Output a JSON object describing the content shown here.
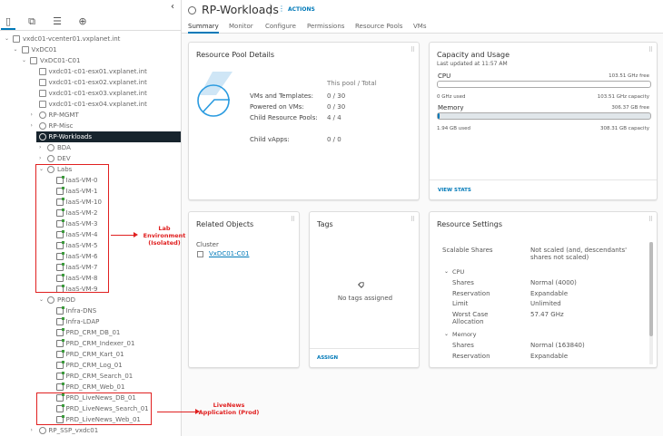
{
  "sidebar": {
    "tabs": [
      {
        "icon": "hosts-clusters-icon"
      },
      {
        "icon": "vms-templates-icon"
      },
      {
        "icon": "storage-icon"
      },
      {
        "icon": "networking-icon"
      }
    ],
    "tree": [
      {
        "label": "vxdc01-vcenter01.vxplanet.int",
        "depth": 0,
        "type": "vcenter",
        "expanded": true
      },
      {
        "label": "VxDC01",
        "depth": 1,
        "type": "datacenter",
        "expanded": true
      },
      {
        "label": "VxDC01-C01",
        "depth": 2,
        "type": "cluster",
        "expanded": true
      },
      {
        "label": "vxdc01-c01-esx01.vxplanet.int",
        "depth": 3,
        "type": "host"
      },
      {
        "label": "vxdc01-c01-esx02.vxplanet.int",
        "depth": 3,
        "type": "host"
      },
      {
        "label": "vxdc01-c01-esx03.vxplanet.int",
        "depth": 3,
        "type": "host"
      },
      {
        "label": "vxdc01-c01-esx04.vxplanet.int",
        "depth": 3,
        "type": "host"
      },
      {
        "label": "RP-MGMT",
        "depth": 3,
        "type": "rp",
        "expanded": false
      },
      {
        "label": "RP-Misc",
        "depth": 3,
        "type": "rp",
        "expanded": false
      },
      {
        "label": "RP-Workloads",
        "depth": 3,
        "type": "rp",
        "expanded": true,
        "selected": true
      },
      {
        "label": "BDA",
        "depth": 4,
        "type": "rp",
        "expanded": false
      },
      {
        "label": "DEV",
        "depth": 4,
        "type": "rp",
        "expanded": false
      },
      {
        "label": "Labs",
        "depth": 4,
        "type": "rp",
        "expanded": true
      },
      {
        "label": "IaaS-VM-0",
        "depth": 5,
        "type": "vm"
      },
      {
        "label": "IaaS-VM-1",
        "depth": 5,
        "type": "vm"
      },
      {
        "label": "IaaS-VM-10",
        "depth": 5,
        "type": "vm"
      },
      {
        "label": "IaaS-VM-2",
        "depth": 5,
        "type": "vm"
      },
      {
        "label": "IaaS-VM-3",
        "depth": 5,
        "type": "vm"
      },
      {
        "label": "IaaS-VM-4",
        "depth": 5,
        "type": "vm"
      },
      {
        "label": "IaaS-VM-5",
        "depth": 5,
        "type": "vm"
      },
      {
        "label": "IaaS-VM-6",
        "depth": 5,
        "type": "vm"
      },
      {
        "label": "IaaS-VM-7",
        "depth": 5,
        "type": "vm"
      },
      {
        "label": "IaaS-VM-8",
        "depth": 5,
        "type": "vm"
      },
      {
        "label": "IaaS-VM-9",
        "depth": 5,
        "type": "vm"
      },
      {
        "label": "PROD",
        "depth": 4,
        "type": "rp",
        "expanded": true
      },
      {
        "label": "Infra-DNS",
        "depth": 5,
        "type": "vm"
      },
      {
        "label": "Infra-LDAP",
        "depth": 5,
        "type": "vm"
      },
      {
        "label": "PRD_CRM_DB_01",
        "depth": 5,
        "type": "vm"
      },
      {
        "label": "PRD_CRM_Indexer_01",
        "depth": 5,
        "type": "vm"
      },
      {
        "label": "PRD_CRM_Kart_01",
        "depth": 5,
        "type": "vm"
      },
      {
        "label": "PRD_CRM_Log_01",
        "depth": 5,
        "type": "vm"
      },
      {
        "label": "PRD_CRM_Search_01",
        "depth": 5,
        "type": "vm"
      },
      {
        "label": "PRD_CRM_Web_01",
        "depth": 5,
        "type": "vm"
      },
      {
        "label": "PRD_LiveNews_DB_01",
        "depth": 5,
        "type": "vm"
      },
      {
        "label": "PRD_LiveNews_Search_01",
        "depth": 5,
        "type": "vm"
      },
      {
        "label": "PRD_LiveNews_Web_01",
        "depth": 5,
        "type": "vm"
      },
      {
        "label": "RP_SSP_vxdc01",
        "depth": 3,
        "type": "rp",
        "expanded": false
      }
    ]
  },
  "annotations": {
    "labs": "Lab Environment (Isolated)",
    "livenews": "LiveNews Application (Prod)",
    "color": "#e02020"
  },
  "header": {
    "title": "RP-Workloads",
    "actions": "ACTIONS"
  },
  "tabs": [
    "Summary",
    "Monitor",
    "Configure",
    "Permissions",
    "Resource Pools",
    "VMs"
  ],
  "details": {
    "title": "Resource Pool Details",
    "col_header": "This pool / Total",
    "rows": [
      {
        "k": "VMs and Templates:",
        "v": "0 / 30"
      },
      {
        "k": "Powered on VMs:",
        "v": "0 / 30"
      },
      {
        "k": "Child Resource Pools:",
        "v": "4 / 4"
      },
      {
        "k": "Child vApps:",
        "v": "0 / 0"
      }
    ]
  },
  "capacity": {
    "title": "Capacity and Usage",
    "updated": "Last updated at 11:57 AM",
    "cpu": {
      "label": "CPU",
      "free": "103.51 GHz free",
      "used": "0 GHz used",
      "capacity": "103.51 GHz capacity",
      "fraction": 0
    },
    "memory": {
      "label": "Memory",
      "free": "306.37 GB free",
      "used": "1.94 GB used",
      "capacity": "308.31 GB capacity",
      "fraction": 0.0063
    },
    "view_stats": "VIEW STATS"
  },
  "related": {
    "title": "Related Objects",
    "cluster_label": "Cluster",
    "cluster_link": "VxDC01-C01"
  },
  "tags": {
    "title": "Tags",
    "empty": "No tags assigned",
    "assign": "ASSIGN"
  },
  "settings": {
    "title": "Resource Settings",
    "scalable_label": "Scalable Shares",
    "scalable_value": "Not scaled (and, descendants' shares not scaled)",
    "cpu": {
      "label": "CPU",
      "rows": [
        {
          "k": "Shares",
          "v": "Normal (4000)"
        },
        {
          "k": "Reservation",
          "v": "Expandable"
        },
        {
          "k": "Limit",
          "v": "Unlimited"
        },
        {
          "k": "Worst Case Allocation",
          "v": "57.47 GHz"
        }
      ]
    },
    "memory": {
      "label": "Memory",
      "rows": [
        {
          "k": "Shares",
          "v": "Normal (163840)"
        },
        {
          "k": "Reservation",
          "v": "Expandable"
        }
      ]
    }
  }
}
